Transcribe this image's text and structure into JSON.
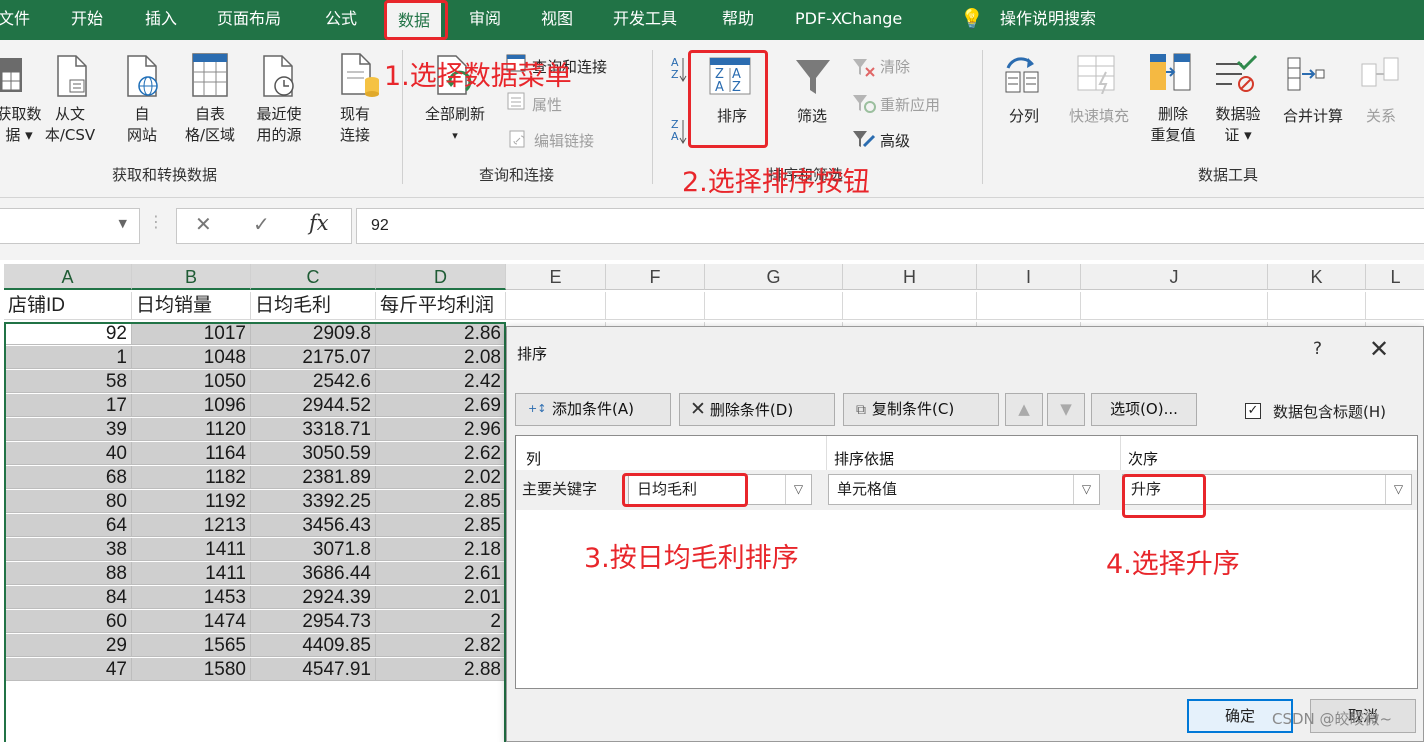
{
  "tabs": [
    "文件",
    "开始",
    "插入",
    "页面布局",
    "公式",
    "数据",
    "审阅",
    "视图",
    "开发工具",
    "帮助",
    "PDF-XChange",
    "操作说明搜索"
  ],
  "tabs_display": [
    "文件",
    "开始",
    "插入",
    "页面布局",
    "公式",
    "数据",
    "审阅",
    "视图",
    "开发工具",
    "帮助",
    "PDF-XChange",
    "操作说明搜索"
  ],
  "ribbon": {
    "get_data": {
      "l1": "获取数",
      "l2": "据 ▾"
    },
    "from_text": {
      "l1": "从文",
      "l2": "本/CSV"
    },
    "from_web": {
      "l1": "自",
      "l2": "网站"
    },
    "from_table": {
      "l1": "自表",
      "l2": "格/区域"
    },
    "recent": {
      "l1": "最近使",
      "l2": "用的源"
    },
    "existing": {
      "l1": "现有",
      "l2": "连接"
    },
    "group1": "获取和转换数据",
    "refresh_all": {
      "l1": "全部刷新",
      "l2": "▾"
    },
    "queries_conn": "查询和连接",
    "properties": "属性",
    "edit_links": "编辑链接",
    "group2": "查询和连接",
    "sort": "排序",
    "filter": "筛选",
    "clear": "清除",
    "reapply": "重新应用",
    "advanced": "高级",
    "group3": "排序和筛选",
    "text_to_cols": "分列",
    "flash_fill": "快速填充",
    "remove_dup": {
      "l1": "删除",
      "l2": "重复值"
    },
    "validation": {
      "l1": "数据验",
      "l2": "证 ▾"
    },
    "consolidate": "合并计算",
    "relations": "关系",
    "group4": "数据工具"
  },
  "annotations": {
    "a1": "1.选择数据菜单",
    "a2": "2.选择排序按钮",
    "a3": "3.按日均毛利排序",
    "a4": "4.选择升序"
  },
  "formula": {
    "value": "92",
    "fx": "fx",
    "cancel": "✕",
    "confirm": "✓"
  },
  "columns": [
    "A",
    "B",
    "C",
    "D",
    "E",
    "F",
    "G",
    "H",
    "I",
    "J",
    "K",
    "L"
  ],
  "headers": [
    "店铺ID",
    "日均销量",
    "日均毛利",
    "每斤平均利润"
  ],
  "rows": [
    [
      "92",
      "1017",
      "2909.8",
      "2.86"
    ],
    [
      "1",
      "1048",
      "2175.07",
      "2.08"
    ],
    [
      "58",
      "1050",
      "2542.6",
      "2.42"
    ],
    [
      "17",
      "1096",
      "2944.52",
      "2.69"
    ],
    [
      "39",
      "1120",
      "3318.71",
      "2.96"
    ],
    [
      "40",
      "1164",
      "3050.59",
      "2.62"
    ],
    [
      "68",
      "1182",
      "2381.89",
      "2.02"
    ],
    [
      "80",
      "1192",
      "3392.25",
      "2.85"
    ],
    [
      "64",
      "1213",
      "3456.43",
      "2.85"
    ],
    [
      "38",
      "1411",
      "3071.8",
      "2.18"
    ],
    [
      "88",
      "1411",
      "3686.44",
      "2.61"
    ],
    [
      "84",
      "1453",
      "2924.39",
      "2.01"
    ],
    [
      "60",
      "1474",
      "2954.73",
      "2"
    ],
    [
      "29",
      "1565",
      "4409.85",
      "2.82"
    ],
    [
      "47",
      "1580",
      "4547.91",
      "2.88"
    ]
  ],
  "dialog": {
    "title": "排序",
    "help": "?",
    "close": "✕",
    "add": "添加条件(A)",
    "delete": "删除条件(D)",
    "copy": "复制条件(C)",
    "options": "选项(O)...",
    "has_header": "数据包含标题(H)",
    "col_header": "列",
    "basis_header": "排序依据",
    "order_header": "次序",
    "primary_key": "主要关键字",
    "key_value": "日均毛利",
    "basis_value": "单元格值",
    "order_value": "升序",
    "ok": "确定",
    "cancel": "取消"
  },
  "watermark": "CSDN @皎皎微~"
}
